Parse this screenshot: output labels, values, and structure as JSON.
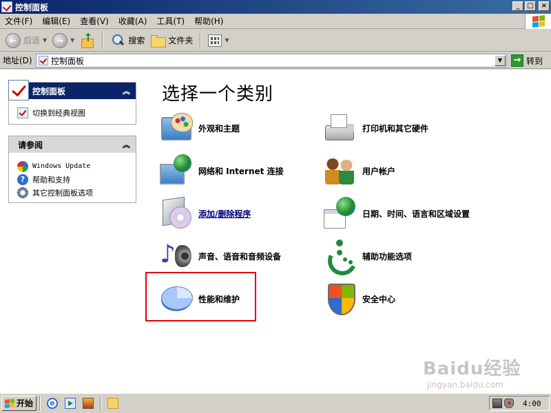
{
  "window": {
    "title": "控制面板",
    "buttons": {
      "minimize": "_",
      "maximize": "□",
      "close": "×"
    }
  },
  "menubar": {
    "items": [
      "文件(F)",
      "编辑(E)",
      "查看(V)",
      "收藏(A)",
      "工具(T)",
      "帮助(H)"
    ]
  },
  "toolbar": {
    "back_label": "后退",
    "search_label": "搜索",
    "folders_label": "文件夹"
  },
  "address": {
    "label": "地址(D)",
    "value": "控制面板",
    "go_label": "转到"
  },
  "sidebar": {
    "control_panel": {
      "title": "控制面板",
      "switch_label": "切换到经典视图"
    },
    "see_also": {
      "title": "请参阅",
      "items": [
        "Windows Update",
        "帮助和支持",
        "其它控制面板选项"
      ]
    }
  },
  "main": {
    "title": "选择一个类别",
    "categories": [
      {
        "label": "外观和主题",
        "icon": "appearance-themes-icon"
      },
      {
        "label": "打印机和其它硬件",
        "icon": "printer-hardware-icon"
      },
      {
        "label": "网络和 Internet 连接",
        "icon": "network-internet-icon"
      },
      {
        "label": "用户帐户",
        "icon": "user-accounts-icon"
      },
      {
        "label": "添加/删除程序",
        "icon": "add-remove-programs-icon"
      },
      {
        "label": "日期、时间、语言和区域设置",
        "icon": "date-time-region-icon"
      },
      {
        "label": "声音、语音和音频设备",
        "icon": "sound-audio-icon"
      },
      {
        "label": "辅助功能选项",
        "icon": "accessibility-icon"
      },
      {
        "label": "性能和维护",
        "icon": "performance-maintenance-icon"
      },
      {
        "label": "安全中心",
        "icon": "security-center-icon"
      }
    ],
    "highlight_color": "#e00000",
    "link_color": "#00007a"
  },
  "taskbar": {
    "start_label": "开始",
    "clock": "4:00"
  },
  "watermark": {
    "text": "Baidu经验",
    "url": "jingyan.baidu.com"
  },
  "colors": {
    "titlebar": "#0a246a",
    "sidebar_header": "#0a246a",
    "window_face": "#d4d0c8"
  }
}
